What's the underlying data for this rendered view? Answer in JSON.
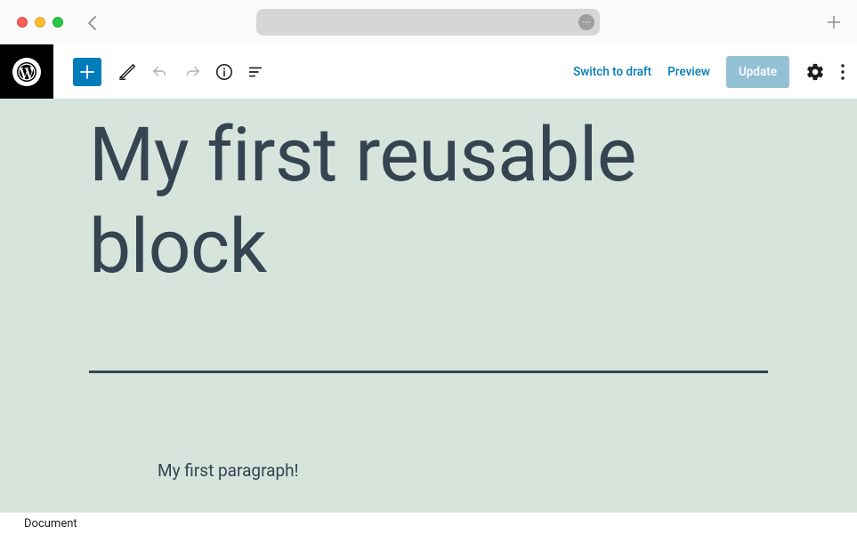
{
  "window": {
    "url_placeholder": "",
    "ellipsis_glyph": "···"
  },
  "toolbar": {
    "switch_to_draft_label": "Switch to draft",
    "preview_label": "Preview",
    "update_label": "Update"
  },
  "editor": {
    "post_title": "My first reusable block",
    "paragraph_text": "My first paragraph!"
  },
  "breadcrumb": {
    "label": "Document"
  },
  "colors": {
    "accent": "#007cba",
    "canvas_bg": "#d6e4dc",
    "title_color": "#344450",
    "update_bg": "#94c0d6"
  }
}
